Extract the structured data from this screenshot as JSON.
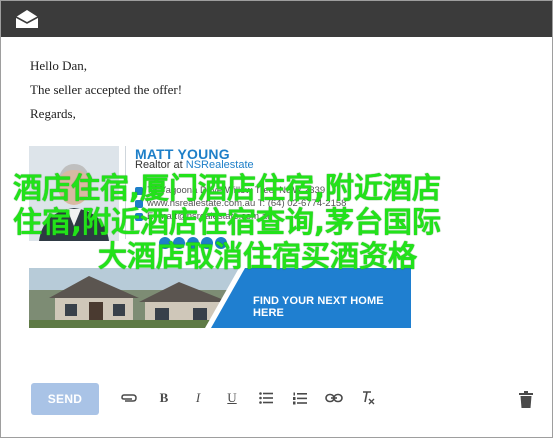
{
  "email": {
    "greeting": "Hello Dan,",
    "message": "The seller accepted the offer!",
    "closing": "Regards,"
  },
  "signature": {
    "name": "MATT YOUNG",
    "role_prefix": "Realtor at ",
    "company": "NSRealestate",
    "address": "74 Yagoona Drive Willow Tree, NSW 2339",
    "website_phone": "www.nsrealestate.com.au  T: (64) 02-6774-2158",
    "email": "E: matt@nsrealestate.com.au"
  },
  "banner": {
    "cta": "FIND YOUR NEXT HOME HERE"
  },
  "overlay_text": {
    "line1": "酒店住宿,厦门酒店住宿,附近酒店",
    "line2": "住宿,附近酒店住宿查询,茅台国际",
    "line3": "大酒店取消住宿买酒资格"
  },
  "toolbar": {
    "send_label": "SEND",
    "bold_label": "B",
    "italic_label": "I",
    "underline_label": "U"
  },
  "colors": {
    "topbar": "#3b3b3b",
    "accent": "#1e7fc8",
    "send_disabled": "#a9c3e6",
    "overlay_green": "#22e21a"
  }
}
